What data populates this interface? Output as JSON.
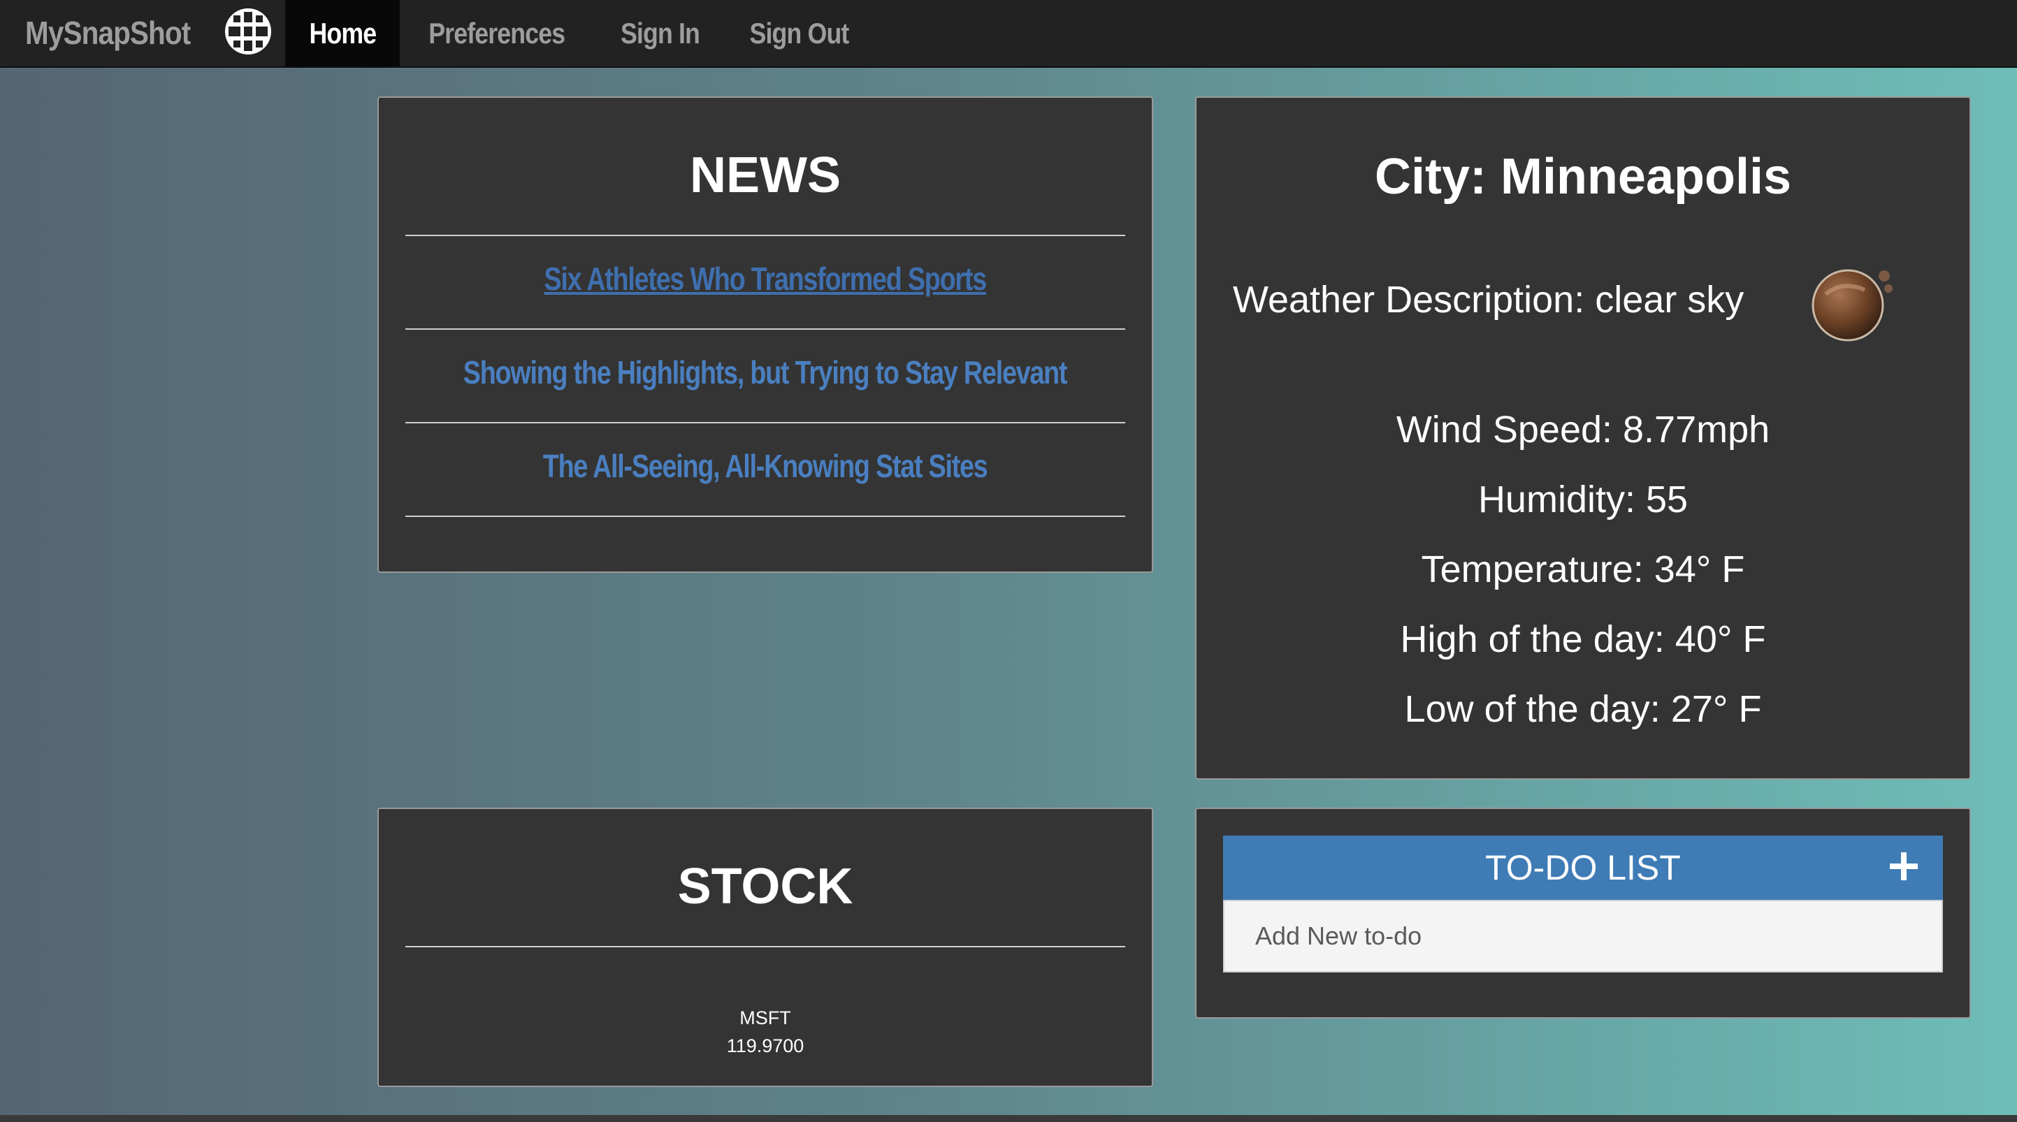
{
  "nav": {
    "brand": "MySnapShot",
    "brand_icon": "globe-icon",
    "items": [
      {
        "label": "Home",
        "active": true
      },
      {
        "label": "Preferences",
        "active": false
      },
      {
        "label": "Sign In",
        "active": false
      },
      {
        "label": "Sign Out",
        "active": false
      }
    ]
  },
  "news": {
    "title": "NEWS",
    "links": [
      "Six Athletes Who Transformed Sports",
      "Showing the Highlights, but Trying to Stay Relevant",
      "The All-Seeing, All-Knowing Stat Sites"
    ]
  },
  "weather": {
    "city": "City: Minneapolis",
    "description": "Weather Description: clear sky",
    "icon": "moon-night-icon",
    "wind": "Wind Speed: 8.77mph",
    "humidity": "Humidity: 55",
    "temperature": "Temperature: 34° F",
    "high": "High of the day: 40° F",
    "low": "Low of the day: 27° F"
  },
  "stock": {
    "title": "STOCK",
    "symbol": "MSFT",
    "price": "119.9700"
  },
  "todo": {
    "title": "TO-DO LIST",
    "add_icon": "plus-icon",
    "placeholder": "Add New to-do"
  },
  "colors": {
    "panel_bg": "#343434",
    "link_blue": "#4a7fc0",
    "todo_header": "#3f7cb6",
    "navbar_bg": "#222222"
  }
}
